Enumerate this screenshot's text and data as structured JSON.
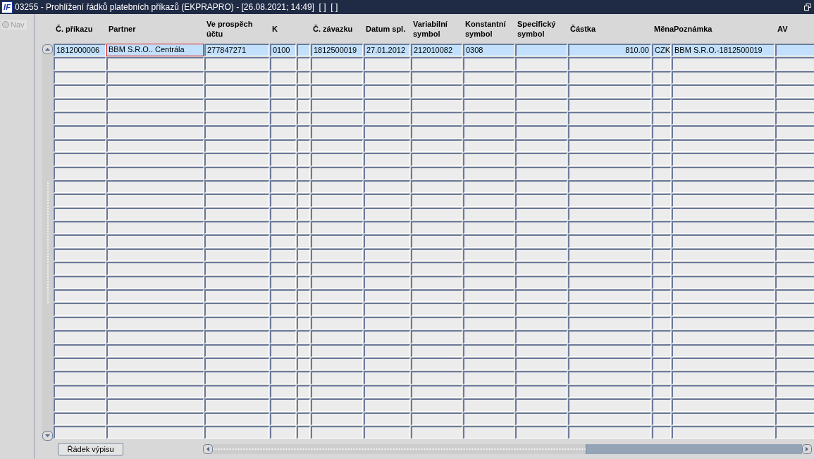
{
  "window": {
    "logo": "IF",
    "title": "03255 - Prohlížení řádků platebních příkazů (EKPRAPRO) - [26.08.2021; 14:49]  [ ]  [ ]"
  },
  "nav": {
    "label": "Nav",
    "selected": false
  },
  "table": {
    "columns": [
      {
        "label": "Č. příkazu",
        "kind": "text"
      },
      {
        "label": "Partner",
        "kind": "text"
      },
      {
        "label": "Ve prospěch účtu",
        "kind": "text"
      },
      {
        "label": "K",
        "kind": "text"
      },
      {
        "kind": "blank"
      },
      {
        "label": "Č. závazku",
        "kind": "text"
      },
      {
        "label": "Datum spl.",
        "kind": "text"
      },
      {
        "label": "Variabilní symbol",
        "kind": "text"
      },
      {
        "label": "Konstantní symbol",
        "kind": "text"
      },
      {
        "label": "Specifický symbol",
        "kind": "text"
      },
      {
        "label": "Částka",
        "kind": "number"
      },
      {
        "label": "Měna",
        "kind": "text"
      },
      {
        "label": "Poznámka",
        "kind": "text"
      },
      {
        "label": "AV",
        "kind": "text"
      }
    ],
    "rows": [
      {
        "selected": true,
        "cells": [
          {
            "text": "1812000006",
            "focused": false
          },
          {
            "text": "BBM S.R.O.. Centrála",
            "focused": true
          },
          {
            "text": "277847271",
            "focused": false
          },
          {
            "text": "0100",
            "focused": false
          },
          {
            "focused": false
          },
          {
            "text": "1812500019",
            "focused": false
          },
          {
            "text": "27.01.2012",
            "focused": false
          },
          {
            "text": "212010082",
            "focused": false
          },
          {
            "text": "0308",
            "focused": false
          },
          {
            "focused": false
          },
          {
            "text": "810.00",
            "focused": false
          },
          {
            "text": "CZK",
            "focused": false
          },
          {
            "text": "BBM S.R.O.-1812500019",
            "focused": false
          },
          {
            "focused": false
          }
        ]
      },
      {
        "selected": false
      },
      {
        "selected": false
      },
      {
        "selected": false
      },
      {
        "selected": false
      },
      {
        "selected": false
      },
      {
        "selected": false
      },
      {
        "selected": false
      },
      {
        "selected": false
      },
      {
        "selected": false
      },
      {
        "selected": false
      },
      {
        "selected": false
      },
      {
        "selected": false
      },
      {
        "selected": false
      },
      {
        "selected": false
      },
      {
        "selected": false
      },
      {
        "selected": false
      },
      {
        "selected": false
      },
      {
        "selected": false
      },
      {
        "selected": false
      },
      {
        "selected": false
      },
      {
        "selected": false
      },
      {
        "selected": false
      },
      {
        "selected": false
      },
      {
        "selected": false
      },
      {
        "selected": false
      },
      {
        "selected": false
      },
      {
        "selected": false
      },
      {
        "selected": false
      }
    ]
  },
  "buttons": [
    {
      "label": "Řádek výpisu"
    }
  ]
}
